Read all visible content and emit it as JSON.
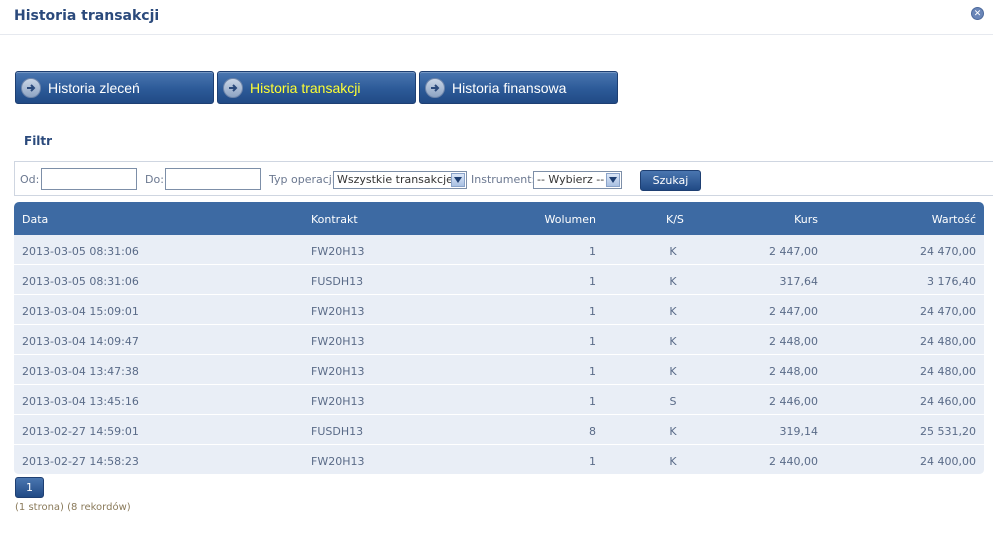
{
  "header": {
    "title": "Historia transakcji",
    "close_icon": "close-icon"
  },
  "tabs": [
    {
      "label": "Historia zleceń",
      "active": false,
      "icon": "arrow-right-icon"
    },
    {
      "label": "Historia transakcji",
      "active": true,
      "icon": "arrow-right-icon"
    },
    {
      "label": "Historia finansowa",
      "active": false,
      "icon": "arrow-right-icon"
    }
  ],
  "filter": {
    "title": "Filtr",
    "from_label": "Od:",
    "from_value": "",
    "to_label": "Do:",
    "to_value": "",
    "type_label": "Typ operacji",
    "type_value": "Wszystkie transakcje",
    "instrument_label": "Instrument:",
    "instrument_value": "-- Wybierz --",
    "search_label": "Szukaj"
  },
  "table": {
    "columns": {
      "data": "Data",
      "kontrakt": "Kontrakt",
      "wolumen": "Wolumen",
      "ks": "K/S",
      "kurs": "Kurs",
      "wartosc": "Wartość"
    },
    "rows": [
      {
        "data": "2013-03-05 08:31:06",
        "kontrakt": "FW20H13",
        "wolumen": "1",
        "ks": "K",
        "kurs": "2 447,00",
        "wartosc": "24 470,00"
      },
      {
        "data": "2013-03-05 08:31:06",
        "kontrakt": "FUSDH13",
        "wolumen": "1",
        "ks": "K",
        "kurs": "317,64",
        "wartosc": "3 176,40"
      },
      {
        "data": "2013-03-04 15:09:01",
        "kontrakt": "FW20H13",
        "wolumen": "1",
        "ks": "K",
        "kurs": "2 447,00",
        "wartosc": "24 470,00"
      },
      {
        "data": "2013-03-04 14:09:47",
        "kontrakt": "FW20H13",
        "wolumen": "1",
        "ks": "K",
        "kurs": "2 448,00",
        "wartosc": "24 480,00"
      },
      {
        "data": "2013-03-04 13:47:38",
        "kontrakt": "FW20H13",
        "wolumen": "1",
        "ks": "K",
        "kurs": "2 448,00",
        "wartosc": "24 480,00"
      },
      {
        "data": "2013-03-04 13:45:16",
        "kontrakt": "FW20H13",
        "wolumen": "1",
        "ks": "S",
        "kurs": "2 446,00",
        "wartosc": "24 460,00"
      },
      {
        "data": "2013-02-27 14:59:01",
        "kontrakt": "FUSDH13",
        "wolumen": "8",
        "ks": "K",
        "kurs": "319,14",
        "wartosc": "25 531,20"
      },
      {
        "data": "2013-02-27 14:58:23",
        "kontrakt": "FW20H13",
        "wolumen": "1",
        "ks": "K",
        "kurs": "2 440,00",
        "wartosc": "24 400,00"
      }
    ]
  },
  "pager": {
    "page": "1",
    "info": "(1 strona) (8 rekordów)"
  },
  "colors": {
    "accent": "#2c5a98",
    "active_tab_text": "#ffff33",
    "row_bg": "#e9eef6"
  }
}
